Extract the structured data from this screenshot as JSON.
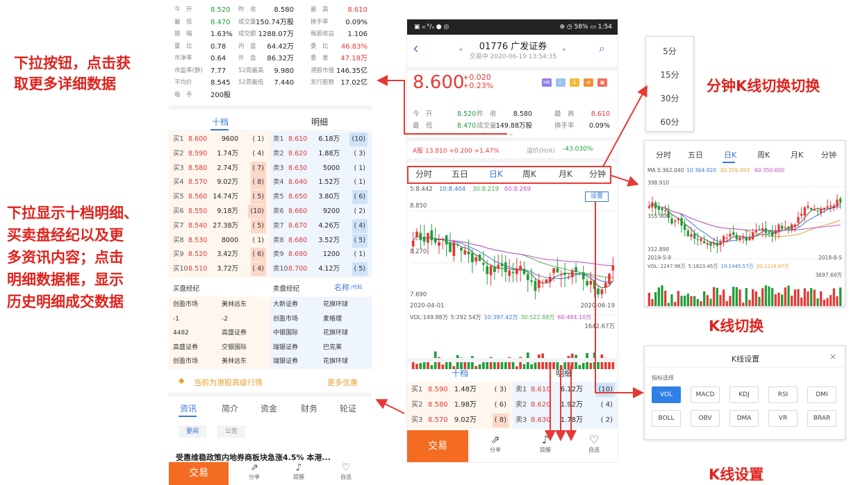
{
  "annotations": {
    "left_top_line1": "下拉按钮，点击获",
    "left_top_line2": "取更多详细数据",
    "left_mid": [
      "下拉显示十档明细、",
      "买卖盘经纪以及更",
      "多资讯内容；点击",
      "明细数据框，显示",
      "历史明细成交数据"
    ],
    "minute_switch": "分钟K线切换切换",
    "k_switch": "K线切换",
    "k_settings": "K线设置"
  },
  "left_stats": [
    [
      "今　开",
      "8.520",
      "昨　收",
      "8.580",
      "最　高",
      "8.610"
    ],
    [
      "最　低",
      "8.470",
      "成交量",
      "150.74万股",
      "换手率",
      "0.09%"
    ],
    [
      "振　幅",
      "1.63%",
      "成交额",
      "1288.07万",
      "每股收益",
      "1.106"
    ],
    [
      "量　比",
      "0.78",
      "内　盘",
      "64.42万",
      "委　比",
      "46.83%"
    ],
    [
      "市净率",
      "0.64",
      "外　盘",
      "86.32万",
      "委　差",
      "47.18万"
    ],
    [
      "市盈率(静)",
      "7.77",
      "52周最高",
      "9.980",
      "港股市值",
      "146.35亿"
    ],
    [
      "平均价",
      "8.545",
      "52周最低",
      "7.440",
      "发行股数",
      "17.02亿"
    ],
    [
      "每　手",
      "200股",
      "",
      "",
      "",
      ""
    ]
  ],
  "tabs": {
    "ten": "十档",
    "detail": "明细"
  },
  "orderbook_left": {
    "bids": [
      [
        "买1",
        "8.600",
        "9600",
        "( 1)"
      ],
      [
        "买2",
        "8.590",
        "1.74万",
        "( 4)"
      ],
      [
        "买3",
        "8.580",
        "2.74万",
        "( 7)"
      ],
      [
        "买4",
        "8.570",
        "9.02万",
        "( 8)"
      ],
      [
        "买5",
        "8.560",
        "14.74万",
        "( 5)"
      ],
      [
        "买6",
        "8.550",
        "9.18万",
        "(10)"
      ],
      [
        "买7",
        "8.540",
        "27.38万",
        "( 5)"
      ],
      [
        "买8",
        "8.530",
        "8000",
        "( 1)"
      ],
      [
        "买9",
        "8.520",
        "3.42万",
        "( 6)"
      ],
      [
        "买10",
        "8.510",
        "3.72万",
        "( 4)"
      ]
    ],
    "asks": [
      [
        "卖1",
        "8.610",
        "6.18万",
        "(10)"
      ],
      [
        "卖2",
        "8.620",
        "1.88万",
        "( 3)"
      ],
      [
        "卖3",
        "8.630",
        "5000",
        "( 1)"
      ],
      [
        "卖4",
        "8.640",
        "1.52万",
        "( 1)"
      ],
      [
        "卖5",
        "8.650",
        "3.80万",
        "( 6)"
      ],
      [
        "卖6",
        "8.660",
        "9200",
        "( 2)"
      ],
      [
        "卖7",
        "8.670",
        "4.26万",
        "( 4)"
      ],
      [
        "卖8",
        "8.680",
        "3.52万",
        "( 5)"
      ],
      [
        "卖9",
        "8.690",
        "1200",
        "( 1)"
      ],
      [
        "卖10",
        "8.700",
        "4.12万",
        "( 5)"
      ]
    ]
  },
  "brokers": {
    "buy_title": "买盘经纪",
    "sell_title": "卖盘经纪",
    "name_label": "名称",
    "code_label": "/代码",
    "rows": [
      [
        "创盈市场",
        "美林远东",
        "大新证券",
        "花旗环球"
      ],
      [
        "-1",
        "-2",
        "创盈市场",
        "麦格理"
      ],
      [
        "4482",
        "高盛证券",
        "中银国际",
        "花旗环球"
      ],
      [
        "高盛证券",
        "交银国际",
        "瑞银证券",
        "巴克莱"
      ],
      [
        "创盈市场",
        "美林远东",
        "瑞银证券",
        "花旗环球"
      ]
    ]
  },
  "promo": {
    "text": "当前为港股高级行情",
    "more": "更多优惠"
  },
  "news_tabs": [
    "资讯",
    "简介",
    "资金",
    "财务",
    "轮证"
  ],
  "news_subtabs": [
    "要闻",
    "公告"
  ],
  "news_headline": "受惠维稳政策内地券商板块急涨4.5%  本港...",
  "bottom": {
    "trade": "交易",
    "share": "分享",
    "remind": "提醒",
    "watch": "自选"
  },
  "phone": {
    "status_left": "▣ ᵢₗₗ ᴷ/ₛ ● ◎",
    "status_right": "⊕ ◷ 58% ▭ 1:54",
    "stock_title": "01776 广发证券",
    "subtitle": "交易中 2020-06-19 13:54:35",
    "price": "8.600",
    "change": "+0.020",
    "change_pct": "+0.23%",
    "hk_icon": "HK",
    "stats": [
      [
        "今　开",
        "8.520",
        "昨　收",
        "8.580",
        "最　高",
        "8.610"
      ],
      [
        "最　低",
        "8.470",
        "成交量",
        "149.88万股",
        "换手率",
        "0.09%"
      ]
    ],
    "a_share": "A股 13.810 +0.200 +1.47%",
    "premium_label": "溢价(H/A)",
    "premium": "-43.030%",
    "ktabs": [
      "分时",
      "五日",
      "日K",
      "周K",
      "月K",
      "分钟"
    ],
    "ma_line": [
      "5:8.442",
      "10:8.404",
      "30:8.219",
      "60:8.269"
    ],
    "settings": "设置",
    "y_high": "8.850",
    "y_mid": "8.270",
    "y_low": "7.690",
    "date_start": "2020-04-01",
    "date_end": "2020-06-19",
    "vol_line": [
      "VOL:149.88万",
      "5:292.54万",
      "10:397.42万",
      "30:522.88万",
      "60:484.10万"
    ],
    "vol_max": "1642.67万",
    "orderbook": {
      "bids": [
        [
          "买1",
          "8.590",
          "1.48万",
          "( 3)"
        ],
        [
          "买2",
          "8.580",
          "1.98万",
          "( 6)"
        ],
        [
          "买3",
          "8.570",
          "9.02万",
          "( 8)"
        ]
      ],
      "asks": [
        [
          "卖1",
          "8.610",
          "6.12万",
          "(10)"
        ],
        [
          "卖2",
          "8.620",
          "1.92万",
          "( 4)"
        ],
        [
          "卖3",
          "8.630",
          "1.78万",
          "( 2)"
        ]
      ]
    }
  },
  "minute_menu": [
    "5分",
    "15分",
    "30分",
    "60分"
  ],
  "kpanel": {
    "tabs": [
      "分时",
      "五日",
      "日K",
      "周K",
      "月K",
      "分钟"
    ],
    "ma_line": [
      "MA 5:362.040",
      "10:364.920",
      "30:359.493",
      "60:350.600"
    ],
    "y_high": "398.910",
    "y_mid": "355.900",
    "y_low": "312.890",
    "date_start": "2019-5-9",
    "date_end": "2019-8-5",
    "vol_line": [
      "VOL: 2247.96万",
      "5:1623.45万",
      "10:1445.57万",
      "20:1216.87万"
    ],
    "vol_max": "3697.69万"
  },
  "settings_panel": {
    "title": "K线设置",
    "close": "×",
    "section": "指标选择",
    "row1": [
      "VOL",
      "MACD",
      "KDJ",
      "RSI",
      "DMI"
    ],
    "row2": [
      "BOLL",
      "OBV",
      "DMA",
      "VR",
      "BRAR"
    ]
  },
  "colors": {
    "up": "#e53935",
    "down": "#1e9e3a",
    "accent": "#3a78d8",
    "trade": "#f36c21",
    "annotation": "#e0231d"
  }
}
